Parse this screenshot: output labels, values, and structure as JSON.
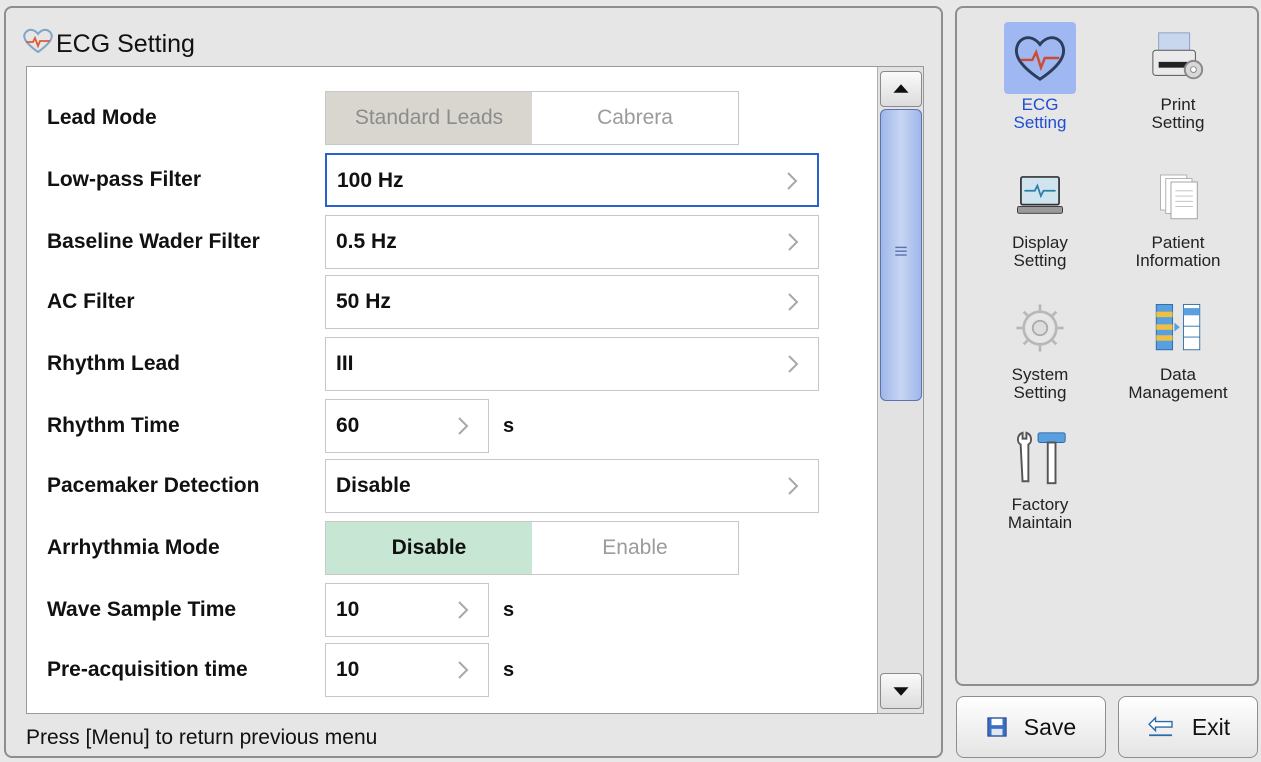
{
  "window": {
    "title": "ECG Setting"
  },
  "settings": {
    "lead_mode": {
      "label": "Lead Mode",
      "options": [
        "Standard Leads",
        "Cabrera"
      ]
    },
    "low_pass": {
      "label": "Low-pass Filter",
      "value": "100 Hz"
    },
    "baseline": {
      "label": "Baseline Wader Filter",
      "value": "0.5 Hz"
    },
    "ac_filter": {
      "label": "AC Filter",
      "value": "50 Hz"
    },
    "rhythm_lead": {
      "label": "Rhythm Lead",
      "value": "III"
    },
    "rhythm_time": {
      "label": "Rhythm Time",
      "value": "60",
      "unit": "s"
    },
    "pacemaker": {
      "label": "Pacemaker Detection",
      "value": "Disable"
    },
    "arrhythmia": {
      "label": "Arrhythmia Mode",
      "options": [
        "Disable",
        "Enable"
      ]
    },
    "wave_sample": {
      "label": "Wave Sample Time",
      "value": "10",
      "unit": "s"
    },
    "pre_acq": {
      "label": "Pre-acquisition time",
      "value": "10",
      "unit": "s"
    }
  },
  "status": "Press [Menu] to return previous menu",
  "menu": {
    "ecg": {
      "line1": "ECG",
      "line2": "Setting"
    },
    "print": {
      "line1": "Print",
      "line2": "Setting"
    },
    "display": {
      "line1": "Display",
      "line2": "Setting"
    },
    "patient": {
      "line1": "Patient",
      "line2": "Information"
    },
    "system": {
      "line1": "System",
      "line2": "Setting"
    },
    "data": {
      "line1": "Data",
      "line2": "Management"
    },
    "factory": {
      "line1": "Factory",
      "line2": "Maintain"
    }
  },
  "buttons": {
    "save": "Save",
    "exit": "Exit"
  },
  "colors": {
    "focus": "#2a5fd0",
    "active_menu_bg": "#9fb8f2",
    "active_menu_text": "#1f4fd0",
    "selected_green": "#c7e6d3"
  }
}
